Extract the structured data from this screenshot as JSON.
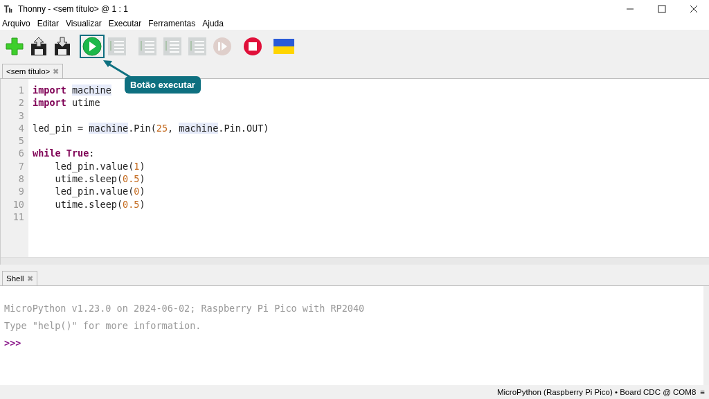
{
  "window": {
    "title": "Thonny  -  <sem título>  @  1 : 1"
  },
  "menu": [
    "Arquivo",
    "Editar",
    "Visualizar",
    "Executar",
    "Ferramentas",
    "Ajuda"
  ],
  "toolbar": [
    {
      "kind": "new",
      "disabled": false,
      "highlighted": false
    },
    {
      "kind": "load",
      "disabled": false,
      "highlighted": false
    },
    {
      "kind": "save",
      "disabled": false,
      "highlighted": false
    },
    {
      "kind": "run",
      "disabled": false,
      "highlighted": true
    },
    {
      "kind": "debug",
      "disabled": true,
      "highlighted": false
    },
    {
      "kind": "step-over",
      "disabled": true,
      "highlighted": false
    },
    {
      "kind": "step-into",
      "disabled": true,
      "highlighted": false
    },
    {
      "kind": "step-out",
      "disabled": true,
      "highlighted": false
    },
    {
      "kind": "resume",
      "disabled": true,
      "highlighted": false
    },
    {
      "kind": "stop",
      "disabled": false,
      "highlighted": false
    },
    {
      "kind": "flag",
      "disabled": false,
      "highlighted": false
    }
  ],
  "callout": {
    "text": "Botão executar"
  },
  "editor_tab": {
    "label": "<sem título>",
    "close": "✖"
  },
  "code": [
    {
      "number": "1",
      "tokens": [
        {
          "text": "import ",
          "kind": "keyword"
        },
        {
          "text": "machine",
          "kind": "match"
        }
      ]
    },
    {
      "number": "2",
      "tokens": [
        {
          "text": "import ",
          "kind": "keyword"
        },
        {
          "text": "utime",
          "kind": "plain"
        }
      ]
    },
    {
      "number": "3"
    },
    {
      "number": "4",
      "tokens": [
        {
          "text": "led_pin = ",
          "kind": "plain"
        },
        {
          "text": "machine",
          "kind": "match"
        },
        {
          "text": ".Pin(",
          "kind": "plain"
        },
        {
          "text": "25",
          "kind": "number"
        },
        {
          "text": ", ",
          "kind": "plain"
        },
        {
          "text": "machine",
          "kind": "match"
        },
        {
          "text": ".Pin.OUT)",
          "kind": "plain"
        }
      ]
    },
    {
      "number": "5"
    },
    {
      "number": "6",
      "tokens": [
        {
          "text": "while ",
          "kind": "keyword"
        },
        {
          "text": "True",
          "kind": "keyword"
        },
        {
          "text": ":",
          "kind": "plain"
        }
      ]
    },
    {
      "number": "7",
      "tokens": [
        {
          "text": "    led_pin.value(",
          "kind": "plain"
        },
        {
          "text": "1",
          "kind": "number"
        },
        {
          "text": ")",
          "kind": "plain"
        }
      ]
    },
    {
      "number": "8",
      "tokens": [
        {
          "text": "    utime.sleep(",
          "kind": "plain"
        },
        {
          "text": "0.5",
          "kind": "number"
        },
        {
          "text": ")",
          "kind": "plain"
        }
      ]
    },
    {
      "number": "9",
      "tokens": [
        {
          "text": "    led_pin.value(",
          "kind": "plain"
        },
        {
          "text": "0",
          "kind": "number"
        },
        {
          "text": ")",
          "kind": "plain"
        }
      ]
    },
    {
      "number": "10",
      "tokens": [
        {
          "text": "    utime.sleep(",
          "kind": "plain"
        },
        {
          "text": "0.5",
          "kind": "number"
        },
        {
          "text": ")",
          "kind": "plain"
        }
      ]
    },
    {
      "number": "11"
    }
  ],
  "shell_tab": {
    "label": "Shell",
    "close": "✖"
  },
  "shell": {
    "lines": [
      "MicroPython v1.23.0 on 2024-06-02; Raspberry Pi Pico with RP2040",
      "Type \"help()\" for more information."
    ],
    "prompt": ">>>"
  },
  "status_bar": {
    "text": "MicroPython (Raspberry Pi Pico)  •  Board CDC @ COM8",
    "menu": "≡"
  }
}
